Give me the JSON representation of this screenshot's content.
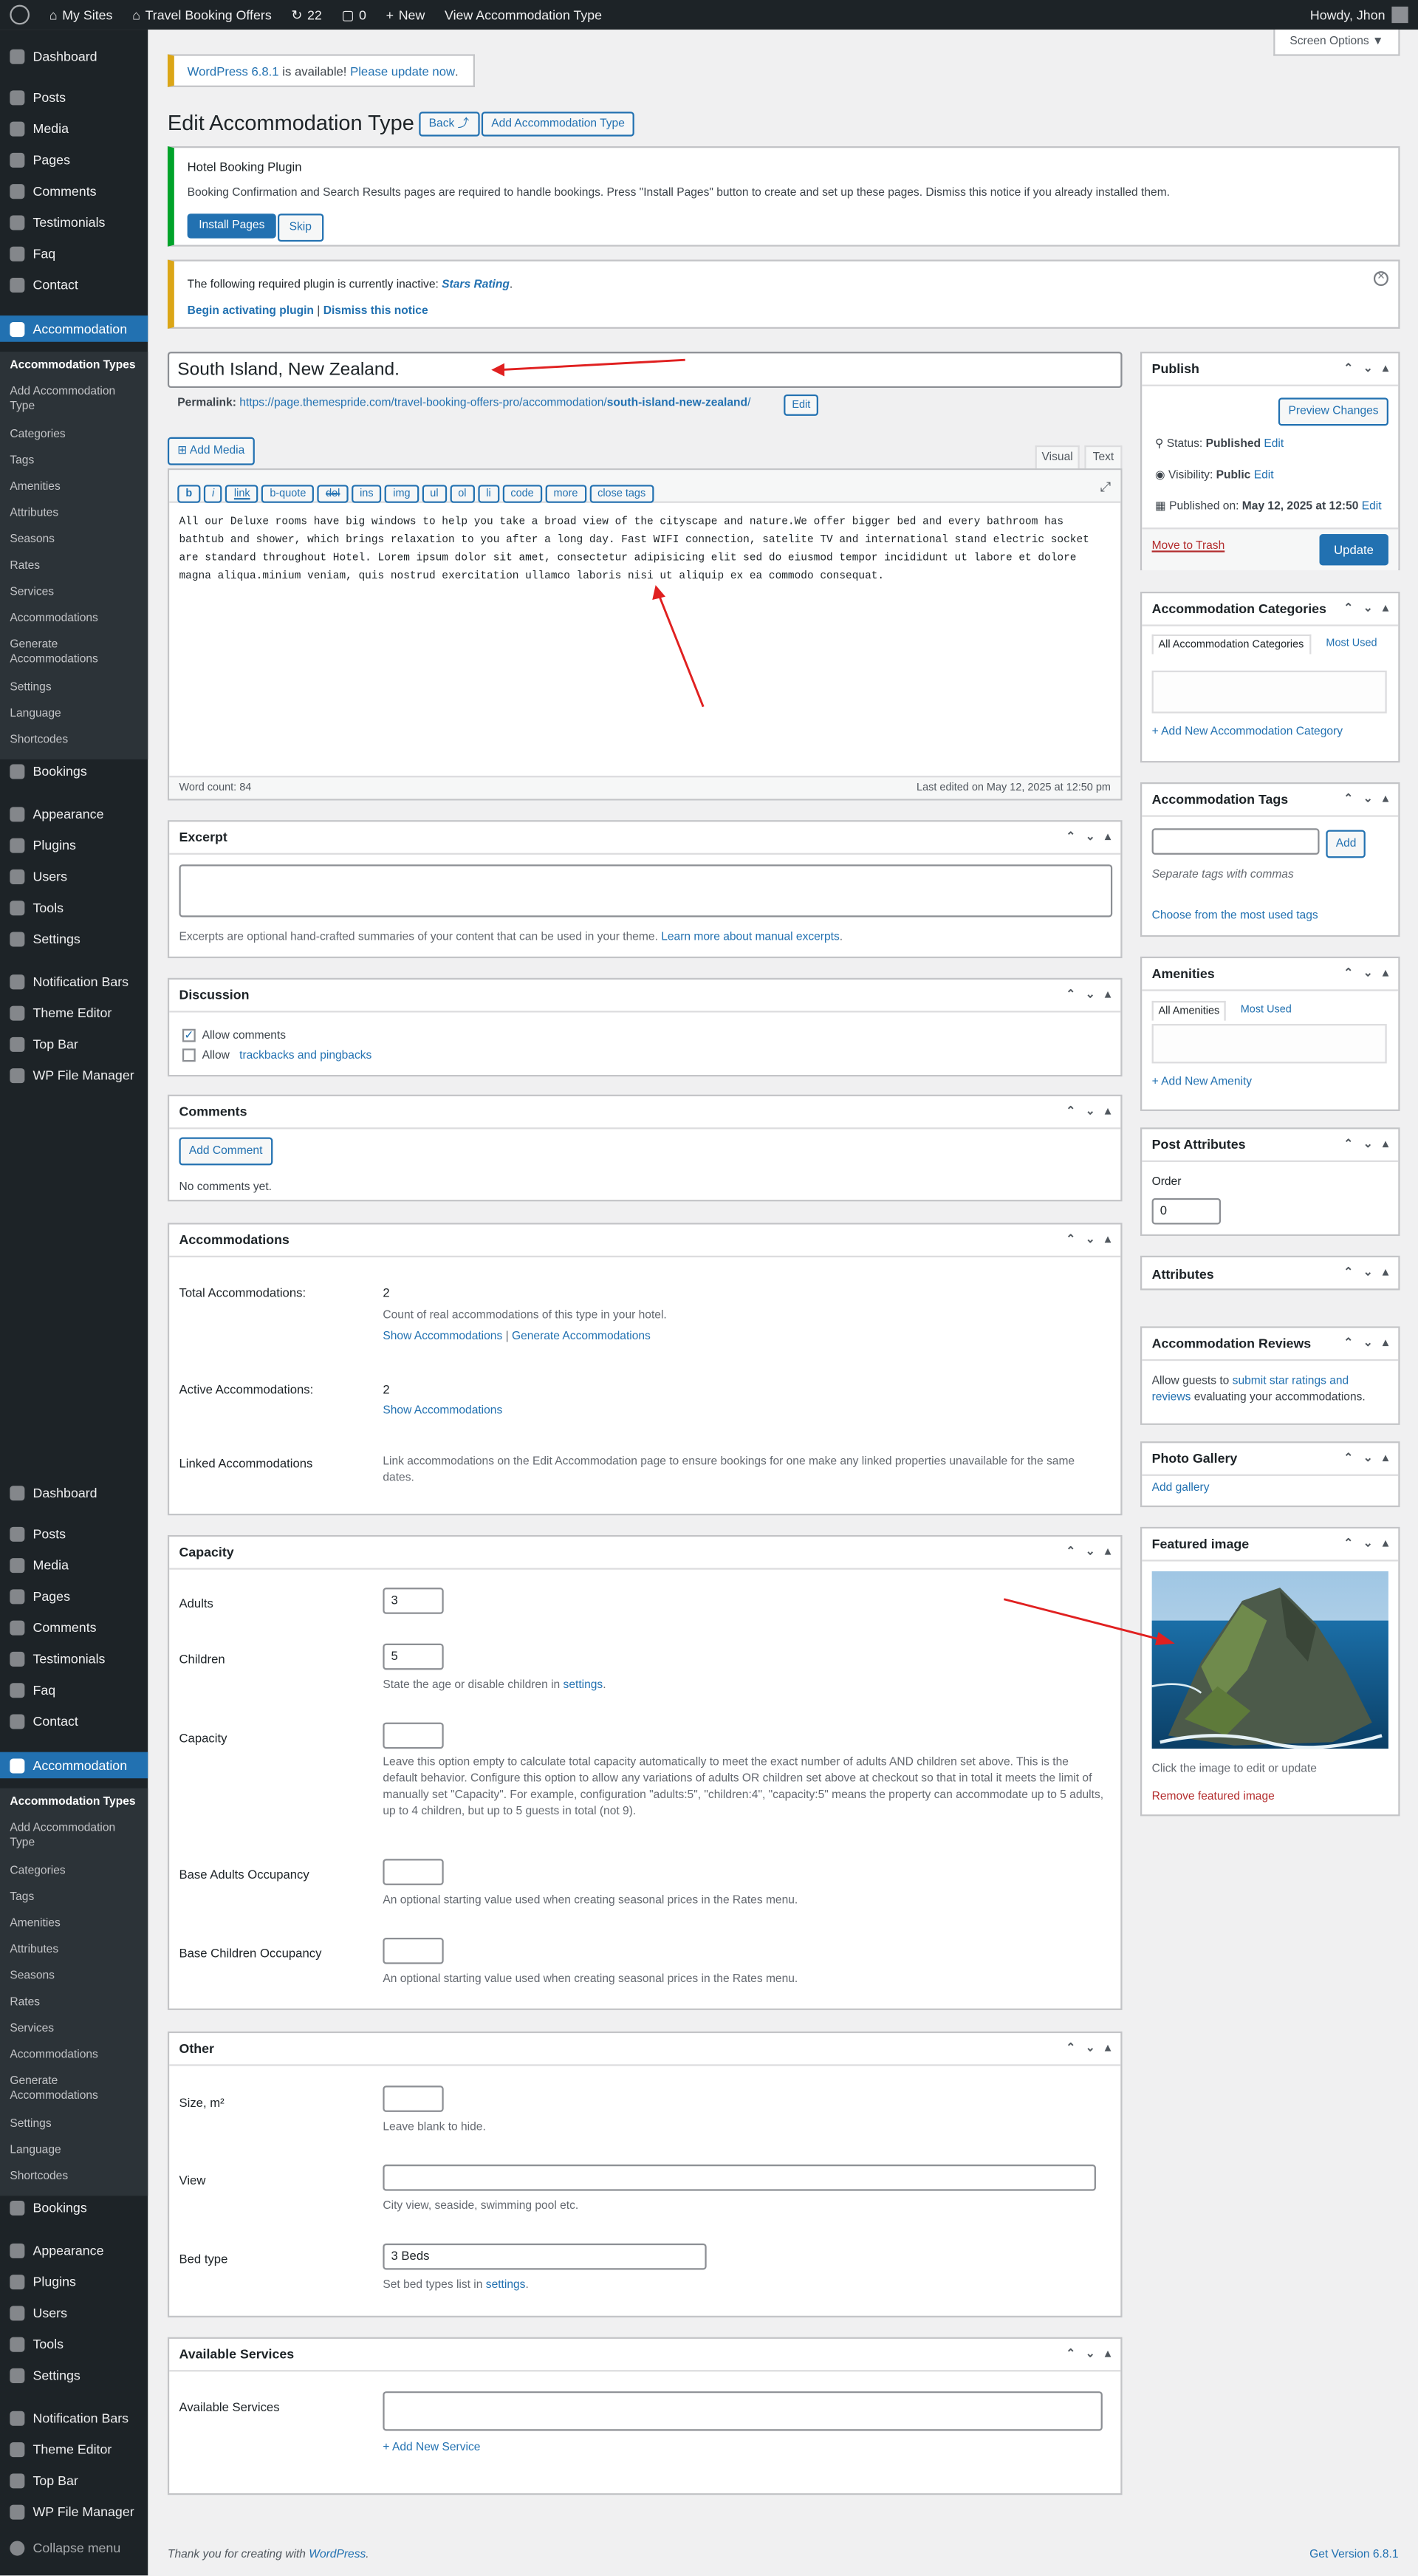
{
  "adminbar": {
    "my_sites": "My Sites",
    "site": "Travel Booking Offers",
    "updates": "22",
    "comments": "0",
    "new": "New",
    "view": "View Accommodation Type",
    "howdy": "Howdy, Jhon"
  },
  "screen_options": "Screen Options ▼",
  "update_notice": {
    "link": "WordPress 6.8.1",
    "text": " is available! ",
    "link2": "Please update now",
    "end": "."
  },
  "page_title": "Edit Accommodation Type",
  "back_button": "Back ⤴",
  "add_button": "Add Accommodation Type",
  "hbp_notice": {
    "title": "Hotel Booking Plugin",
    "text": "Booking Confirmation and Search Results pages are required to handle bookings. Press \"Install Pages\" button to create and set up these pages. Dismiss this notice if you already installed them.",
    "install": "Install Pages",
    "skip": "Skip"
  },
  "plugin_notice": {
    "text": "The following required plugin is currently inactive: ",
    "plugin": "Stars Rating",
    "end": ".",
    "begin": "Begin activating plugin",
    "sep": " | ",
    "dismiss": "Dismiss this notice"
  },
  "post_title": "South Island, New Zealand.",
  "permalink": {
    "label": "Permalink:",
    "url": "https://page.themespride.com/travel-booking-offers-pro/accommodation/",
    "slug": "south-island-new-zealand",
    "end": "/",
    "edit": "Edit"
  },
  "editor": {
    "add_media": "Add Media",
    "visual": "Visual",
    "text": "Text",
    "buttons": [
      "b",
      "i",
      "link",
      "b-quote",
      "del",
      "ins",
      "img",
      "ul",
      "ol",
      "li",
      "code",
      "more",
      "close tags"
    ],
    "content": "All our Deluxe rooms have big windows to help you take a broad view of the cityscape and nature.We offer bigger bed and every bathroom has bathtub and shower, which brings relaxation to you after a long day. Fast WIFI connection, satelite TV and international stand electric socket are standard throughout Hotel. Lorem ipsum dolor sit amet, consectetur adipisicing elit sed do eiusmod tempor incididunt ut labore et dolore magna aliqua.minium veniam, quis nostrud exercitation ullamco laboris nisi ut aliquip ex ea commodo consequat.",
    "word_count": "Word count: 84",
    "last_edited": "Last edited on May 12, 2025 at 12:50 pm"
  },
  "excerpt": {
    "title": "Excerpt",
    "desc": "Excerpts are optional hand-crafted summaries of your content that can be used in your theme. ",
    "link": "Learn more about manual excerpts",
    "end": "."
  },
  "discussion": {
    "title": "Discussion",
    "allow_comments": "Allow comments",
    "allow_tb": "Allow ",
    "tb_link": "trackbacks and pingbacks"
  },
  "comments": {
    "title": "Comments",
    "add": "Add Comment",
    "none": "No comments yet."
  },
  "accommodations": {
    "title": "Accommodations",
    "total_label": "Total Accommodations:",
    "total_value": "2",
    "total_desc": "Count of real accommodations of this type in your hotel.",
    "show": "Show Accommodations",
    "sep": " | ",
    "generate": "Generate Accommodations",
    "active_label": "Active Accommodations:",
    "active_value": "2",
    "active_show": "Show Accommodations",
    "linked_label": "Linked Accommodations",
    "linked_desc": "Link accommodations on the Edit Accommodation page to ensure bookings for one make any linked properties unavailable for the same dates."
  },
  "capacity": {
    "title": "Capacity",
    "adults": "Adults",
    "adults_val": "3",
    "children": "Children",
    "children_val": "5",
    "children_desc": "State the age or disable children in ",
    "settings": "settings",
    "dot": ".",
    "capacity": "Capacity",
    "capacity_desc": "Leave this option empty to calculate total capacity automatically to meet the exact number of adults AND children set above. This is the default behavior. Configure this option to allow any variations of adults OR children set above at checkout so that in total it meets the limit of manually set \"Capacity\". For example, configuration \"adults:5\", \"children:4\", \"capacity:5\" means the property can accommodate up to 5 adults, up to 4 children, but up to 5 guests in total (not 9).",
    "base_adults": "Base Adults Occupancy",
    "base_children": "Base Children Occupancy",
    "base_desc": "An optional starting value used when creating seasonal prices in the Rates menu."
  },
  "other": {
    "title": "Other",
    "size": "Size, m²",
    "size_desc": "Leave blank to hide.",
    "view": "View",
    "view_desc": "City view, seaside, swimming pool etc.",
    "bed": "Bed type",
    "bed_val": "3 Beds",
    "bed_desc": "Set bed types list in ",
    "settings": "settings",
    "dot": "."
  },
  "services": {
    "title": "Available Services",
    "label": "Available Services",
    "add": "+ Add New Service"
  },
  "footer": {
    "thanks": "Thank you for creating with ",
    "wp": "WordPress",
    "end": ".",
    "version": "Get Version 6.8.1"
  },
  "publish": {
    "title": "Publish",
    "preview": "Preview Changes",
    "status": "Status: ",
    "status_val": "Published",
    "visibility": "Visibility: ",
    "vis_val": "Public",
    "published": "Published on: ",
    "pub_val": "May 12, 2025 at 12:50",
    "edit": "Edit",
    "trash": "Move to Trash",
    "update": "Update"
  },
  "acc_categories": {
    "title": "Accommodation Categories",
    "all": "All Accommodation Categories",
    "most": "Most Used",
    "add": "+ Add New Accommodation Category"
  },
  "acc_tags": {
    "title": "Accommodation Tags",
    "add": "Add",
    "sep": "Separate tags with commas",
    "choose": "Choose from the most used tags"
  },
  "amenities": {
    "title": "Amenities",
    "all": "All Amenities",
    "most": "Most Used",
    "add": "+ Add New Amenity"
  },
  "post_attr": {
    "title": "Post Attributes",
    "order": "Order",
    "order_val": "0"
  },
  "attributes": {
    "title": "Attributes"
  },
  "reviews": {
    "title": "Accommodation Reviews",
    "text1": "Allow guests to ",
    "link": "submit star ratings and reviews",
    "text2": " evaluating your accommodations."
  },
  "gallery": {
    "title": "Photo Gallery",
    "add": "Add gallery"
  },
  "featured": {
    "title": "Featured image",
    "hint": "Click the image to edit or update",
    "remove": "Remove featured image"
  },
  "menu": {
    "dashboard": "Dashboard",
    "posts": "Posts",
    "media": "Media",
    "pages": "Pages",
    "comments": "Comments",
    "testimonials": "Testimonials",
    "faq": "Faq",
    "contact": "Contact",
    "accommodation": "Accommodation",
    "bookings": "Bookings",
    "appearance": "Appearance",
    "plugins": "Plugins",
    "users": "Users",
    "tools": "Tools",
    "settings": "Settings",
    "notification": "Notification Bars",
    "theme_editor": "Theme Editor",
    "top_bar": "Top Bar",
    "file_manager": "WP File Manager",
    "collapse": "Collapse menu",
    "sub": [
      "Accommodation Types",
      "Add Accommodation Type",
      "Categories",
      "Tags",
      "Amenities",
      "Attributes",
      "Seasons",
      "Rates",
      "Services",
      "Accommodations",
      "Generate Accommodations",
      "Settings",
      "Language",
      "Shortcodes"
    ]
  },
  "colors": {
    "admin_dark": "#1d2327",
    "accent": "#2271b1",
    "warning": "#dba617",
    "success": "#00a32a",
    "danger": "#d63638"
  }
}
